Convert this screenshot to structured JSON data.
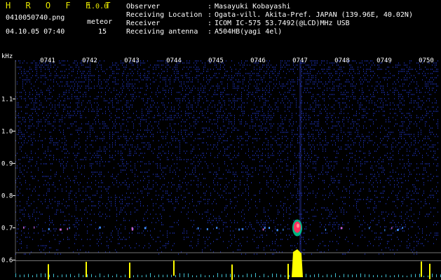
{
  "app": {
    "title": "H R O F F T",
    "version": "1.0.0"
  },
  "file": {
    "name": "0410050740.png",
    "datetime": "04.10.05 07:40"
  },
  "meteor": {
    "label": "meteor",
    "count": "15"
  },
  "station_info": [
    {
      "label": "Observer",
      "value": "Masayuki Kobayashi"
    },
    {
      "label": "Receiving Location",
      "value": "Ogata-vill. Akita-Pref. JAPAN (139.96E, 40.02N)"
    },
    {
      "label": "Receiver",
      "value": "ICOM IC-575 53.7492(@LCD)MHz USB"
    },
    {
      "label": "Receiving antenna",
      "value": "A504HB(yagi 4el)"
    }
  ],
  "spectrogram": {
    "y_unit": "kHz",
    "time_labels": [
      "0741",
      "0742",
      "0743",
      "0744",
      "0745",
      "0746",
      "0747",
      "0748",
      "0749",
      "0750"
    ],
    "freq_labels": [
      "1.1",
      "1.0",
      "0.9",
      "0.8",
      "0.7",
      "0.6"
    ],
    "freq_range_khz": [
      0.56,
      1.22
    ],
    "meteor_event_time": "0747",
    "colors": {
      "background": "#000000",
      "noise": "#1a2a9a",
      "echo_hot": "#ff3060",
      "echo_warm": "#00e0a0",
      "amplitude": "#ffff00"
    }
  }
}
